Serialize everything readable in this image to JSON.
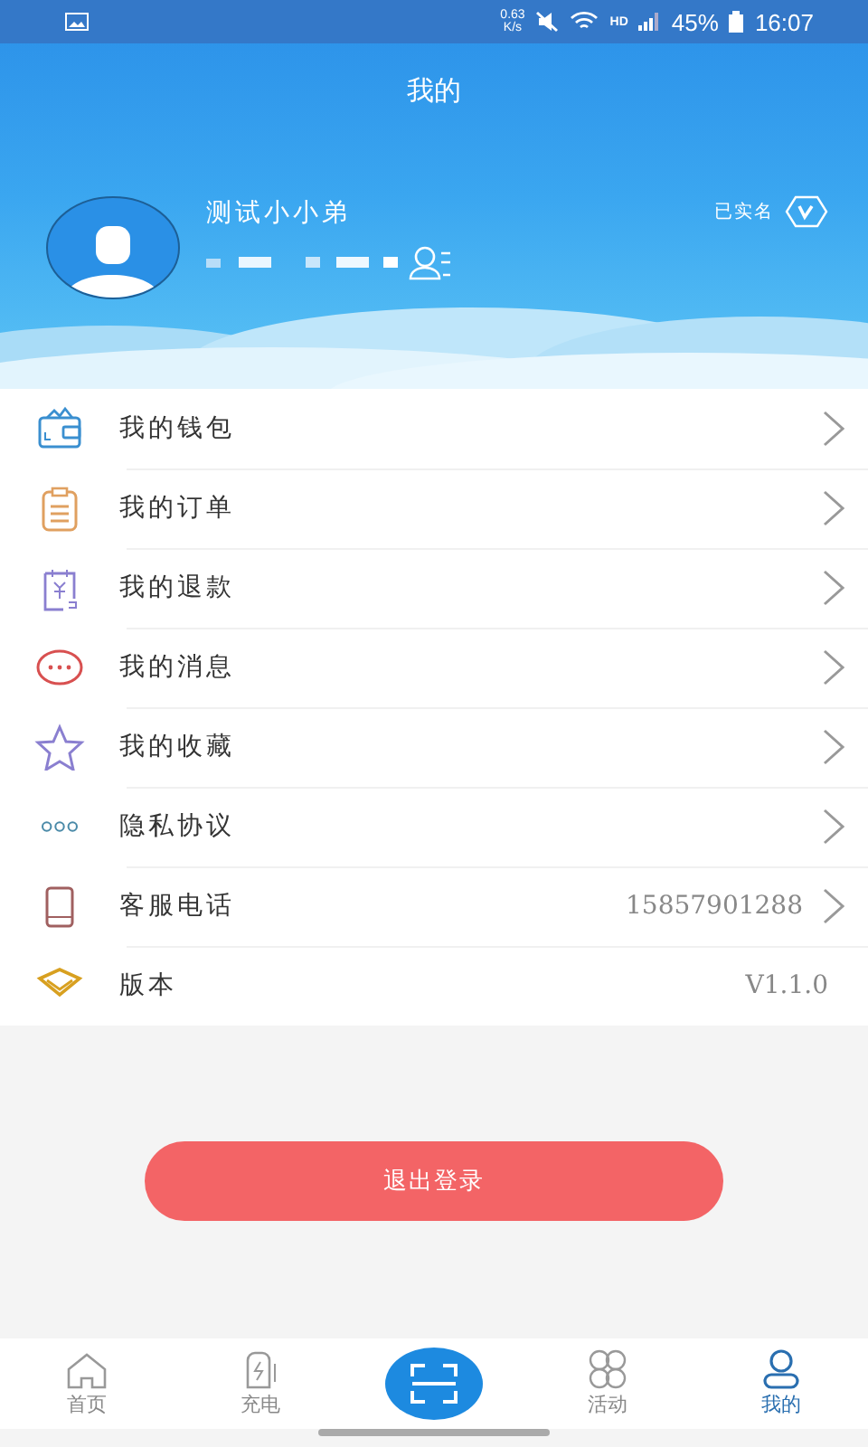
{
  "status_bar": {
    "speed": "0.63\nK/s",
    "network": "HD",
    "battery": "45%",
    "time": "16:07"
  },
  "header": {
    "title": "我的"
  },
  "profile": {
    "name": "测试小小弟",
    "verified_label": "已实名"
  },
  "menu": [
    {
      "kind": "link",
      "label": "我的钱包"
    },
    {
      "kind": "link",
      "label": "我的订单"
    },
    {
      "kind": "link",
      "label": "我的退款"
    },
    {
      "kind": "link",
      "label": "我的消息"
    },
    {
      "kind": "link",
      "label": "我的收藏"
    },
    {
      "kind": "link",
      "label": "隐私协议"
    },
    {
      "kind": "link",
      "label": "客服电话",
      "value": "15857901288"
    },
    {
      "kind": "info",
      "label": "版本",
      "value": "V1.1.0"
    }
  ],
  "logout_button": "退出登录",
  "tab_bar": [
    {
      "kind": "tab",
      "label": "首页",
      "selected": false
    },
    {
      "kind": "tab",
      "label": "充电",
      "selected": false
    },
    {
      "kind": "scan"
    },
    {
      "kind": "tab",
      "label": "活动",
      "selected": false
    },
    {
      "kind": "tab",
      "label": "我的",
      "selected": true
    }
  ]
}
